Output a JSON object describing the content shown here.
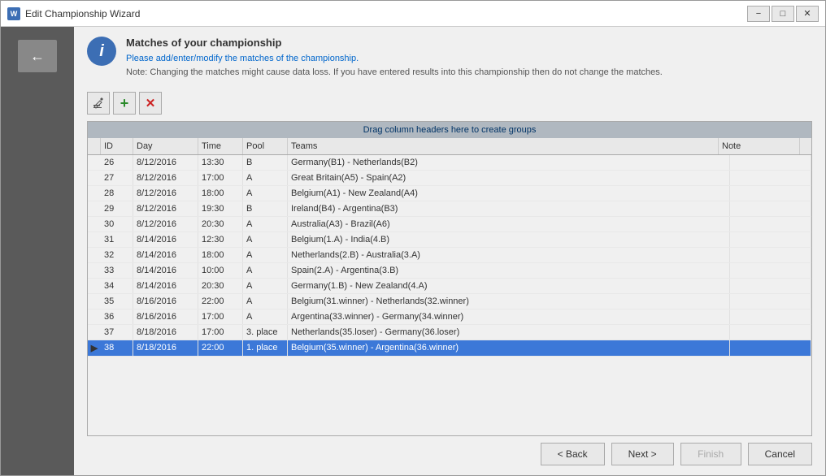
{
  "window": {
    "title": "Edit Championship Wizard",
    "icon": "W"
  },
  "titleButtons": {
    "minimize": "−",
    "restore": "□",
    "close": "✕"
  },
  "header": {
    "title": "Matches of your championship",
    "description": "Please add/enter/modify the matches of the championship.",
    "note": "Note: Changing the matches might cause data loss. If you have entered results into this championship then do not change the matches."
  },
  "toolbar": {
    "edit_label": "✏",
    "add_label": "+",
    "delete_label": "✕"
  },
  "grid": {
    "group_header": "Drag column headers here to create groups",
    "columns": [
      "ID",
      "Day",
      "Time",
      "Pool",
      "Teams",
      "Note"
    ],
    "rows": [
      {
        "id": "26",
        "day": "8/12/2016",
        "time": "13:30",
        "pool": "B",
        "teams": "Germany(B1) - Netherlands(B2)",
        "note": ""
      },
      {
        "id": "27",
        "day": "8/12/2016",
        "time": "17:00",
        "pool": "A",
        "teams": "Great Britain(A5) - Spain(A2)",
        "note": ""
      },
      {
        "id": "28",
        "day": "8/12/2016",
        "time": "18:00",
        "pool": "A",
        "teams": "Belgium(A1) - New Zealand(A4)",
        "note": ""
      },
      {
        "id": "29",
        "day": "8/12/2016",
        "time": "19:30",
        "pool": "B",
        "teams": "Ireland(B4) - Argentina(B3)",
        "note": ""
      },
      {
        "id": "30",
        "day": "8/12/2016",
        "time": "20:30",
        "pool": "A",
        "teams": "Australia(A3) - Brazil(A6)",
        "note": ""
      },
      {
        "id": "31",
        "day": "8/14/2016",
        "time": "12:30",
        "pool": "A",
        "teams": "Belgium(1.A) - India(4.B)",
        "note": ""
      },
      {
        "id": "32",
        "day": "8/14/2016",
        "time": "18:00",
        "pool": "A",
        "teams": "Netherlands(2.B) - Australia(3.A)",
        "note": ""
      },
      {
        "id": "33",
        "day": "8/14/2016",
        "time": "10:00",
        "pool": "A",
        "teams": "Spain(2.A) - Argentina(3.B)",
        "note": ""
      },
      {
        "id": "34",
        "day": "8/14/2016",
        "time": "20:30",
        "pool": "A",
        "teams": "Germany(1.B) - New Zealand(4.A)",
        "note": ""
      },
      {
        "id": "35",
        "day": "8/16/2016",
        "time": "22:00",
        "pool": "A",
        "teams": "Belgium(31.winner) - Netherlands(32.winner)",
        "note": ""
      },
      {
        "id": "36",
        "day": "8/16/2016",
        "time": "17:00",
        "pool": "A",
        "teams": "Argentina(33.winner) - Germany(34.winner)",
        "note": ""
      },
      {
        "id": "37",
        "day": "8/18/2016",
        "time": "17:00",
        "pool": "3. place",
        "teams": "Netherlands(35.loser) - Germany(36.loser)",
        "note": ""
      },
      {
        "id": "38",
        "day": "8/18/2016",
        "time": "22:00",
        "pool": "1. place",
        "teams": "Belgium(35.winner) - Argentina(36.winner)",
        "note": "",
        "selected": true
      }
    ]
  },
  "footer": {
    "back_label": "< Back",
    "next_label": "Next >",
    "finish_label": "Finish",
    "cancel_label": "Cancel"
  }
}
